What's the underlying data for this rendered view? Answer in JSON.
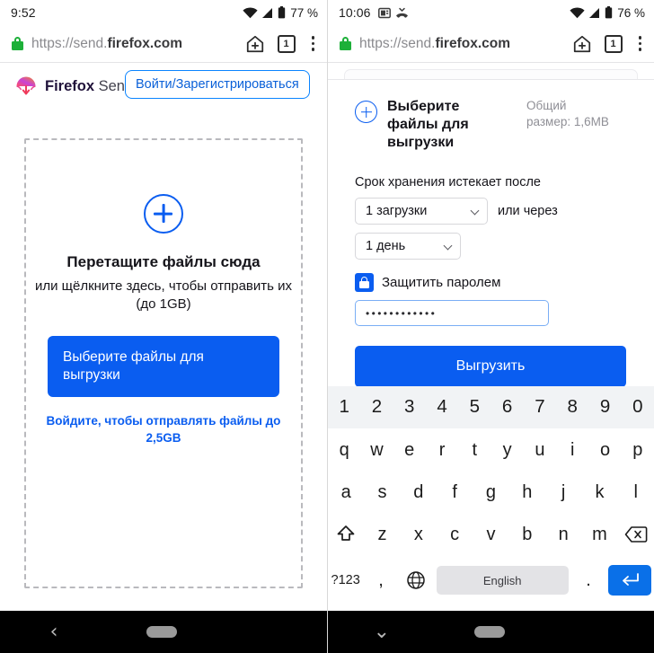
{
  "colors": {
    "accent_blue": "#0a5df0",
    "link_blue": "#0a60d8",
    "lock_green": "#1db039",
    "keyboard_enter": "#0a70e8",
    "muted_text": "#8f8f96"
  },
  "left": {
    "status": {
      "time": "9:52",
      "battery": "77 %"
    },
    "url": {
      "scheme_host": "https://send.",
      "domain": "firefox.com",
      "tab_count": "1"
    },
    "brand": {
      "name_bold": "Firefox",
      "name_light": "Send"
    },
    "signin_button": "Войти/Зарегистрироваться",
    "dropzone": {
      "title": "Перетащите файлы сюда",
      "subtitle": "или щёлкните здесь, чтобы отправить их (до 1GB)",
      "upload_button": "Выберите файлы для выгрузки",
      "signin_link": "Войдите, чтобы отправлять файлы до 2,5GB"
    }
  },
  "right": {
    "status": {
      "time": "10:06",
      "battery": "76 %"
    },
    "url": {
      "scheme_host": "https://send.",
      "domain": "firefox.com",
      "tab_count": "1"
    },
    "file_header": {
      "title": "Выберите файлы для выгрузки",
      "size_label": "Общий размер: 1,6MB"
    },
    "expiry": {
      "label": "Срок хранения истекает после",
      "downloads_value": "1 загрузки",
      "conjunction": "или через",
      "time_value": "1 день"
    },
    "password": {
      "checkbox_label": "Защитить паролем",
      "value": "••••••••••••",
      "checked": true
    },
    "submit_button": "Выгрузить",
    "keyboard": {
      "row_numbers": [
        "1",
        "2",
        "3",
        "4",
        "5",
        "6",
        "7",
        "8",
        "9",
        "0"
      ],
      "row_top": [
        "q",
        "w",
        "e",
        "r",
        "t",
        "y",
        "u",
        "i",
        "o",
        "p"
      ],
      "row_mid": [
        "a",
        "s",
        "d",
        "f",
        "g",
        "h",
        "j",
        "k",
        "l"
      ],
      "row_low": [
        "z",
        "x",
        "c",
        "v",
        "b",
        "n",
        "m"
      ],
      "symbols_key": "?123",
      "comma_key": ",",
      "period_key": ".",
      "space_key": "English"
    }
  }
}
